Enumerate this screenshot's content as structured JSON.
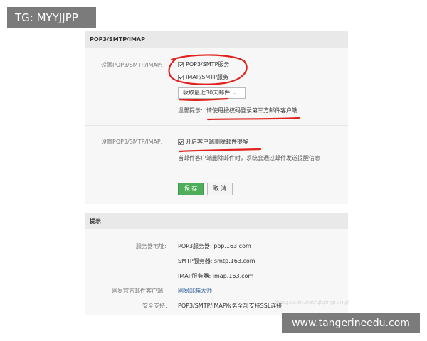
{
  "overlays": {
    "tg_badge": "TG: MYYJJPP",
    "site_badge": "www.tangerineedu.com",
    "faint_watermark": "/blog.csdn.net/qiqingrong/"
  },
  "settings_panel": {
    "title": "POP3/SMTP/IMAP",
    "row1_label": "设置POP3/SMTP/IMAP:",
    "checkbox_pop3": "POP3/SMTP服务",
    "checkbox_imap": "IMAP/SMTP服务",
    "select_value": "收取最近30天邮件",
    "tip_label": "温馨提示:",
    "tip_text": "请使用授权码登录第三方邮件客户端",
    "row2_label": "设置POP3/SMTP/IMAP:",
    "checkbox_delete_notice": "开启客户端删除邮件提醒",
    "delete_notice_desc": "当邮件客户端删除邮件时，系统会通过邮件发送提醒信息",
    "save_label": "保 存",
    "cancel_label": "取 消"
  },
  "tips_panel": {
    "title": "提示",
    "server_label": "服务器地址:",
    "pop3_server": "POP3服务器: pop.163.com",
    "smtp_server": "SMTP服务器: smtp.163.com",
    "imap_server": "IMAP服务器: imap.163.com",
    "client_label": "网易官方邮件客户端:",
    "client_link": "网易邮箱大师",
    "security_label": "安全支持:",
    "security_text": "POP3/SMTP/IMAP服务全部支持SSL连接"
  },
  "colors": {
    "annotation_red": "#e0221e",
    "save_green": "#4fae5b",
    "link_blue": "#2c5c9a"
  }
}
